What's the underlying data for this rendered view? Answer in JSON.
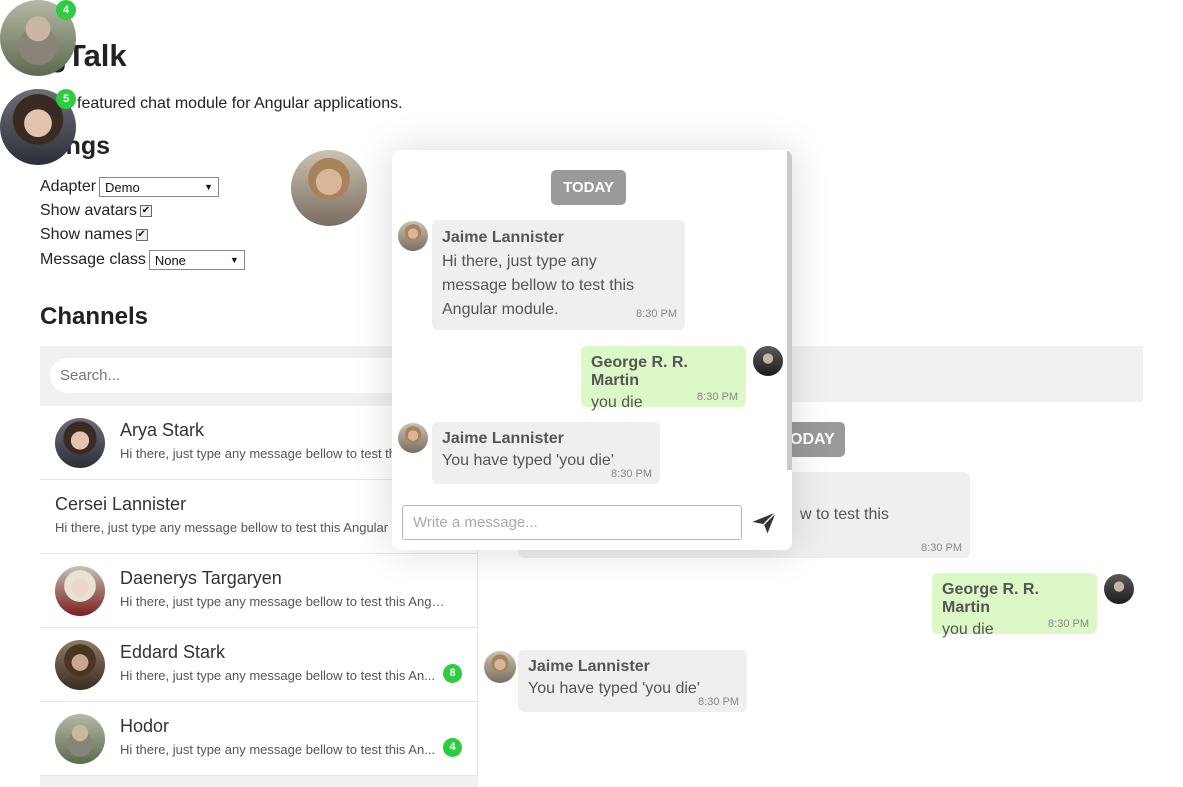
{
  "header": {
    "title": "gTalk",
    "subtitle": "featured chat module for Angular applications.",
    "settings_heading": "ttings"
  },
  "settings": {
    "adapter_label": "Adapter",
    "adapter_value": "Demo",
    "show_avatars_label": "Show avatars",
    "show_avatars_checked": true,
    "show_names_label": "Show names",
    "show_names_checked": true,
    "message_class_label": "Message class",
    "message_class_value": "None"
  },
  "floating_avatars": [
    {
      "icon": "hodor-avatar",
      "badge": "4"
    },
    {
      "icon": "arya-avatar",
      "badge": "5"
    },
    {
      "icon": "jaime-avatar",
      "badge": ""
    }
  ],
  "channels": {
    "heading": "Channels",
    "search_placeholder": "Search...",
    "friends": [
      {
        "name": "Arya Stark",
        "snippet": "Hi there, just type any message bellow to test this Angular module.",
        "badge": ""
      },
      {
        "name": "Cersei Lannister",
        "snippet": "Hi there, just type any message bellow to test this Angular",
        "badge": ""
      },
      {
        "name": "Daenerys Targaryen",
        "snippet": "Hi there, just type any message bellow to test this Angul...",
        "badge": ""
      },
      {
        "name": "Eddard Stark",
        "snippet": "Hi there, just type any message bellow to test this An...",
        "badge": "8"
      },
      {
        "name": "Hodor",
        "snippet": "Hi there, just type any message bellow to test this An...",
        "badge": "4"
      }
    ]
  },
  "background_window": {
    "date_label": "ODAY",
    "partial_message_text": "w to test this",
    "partial_message_time": "8:30 PM",
    "messages": [
      {
        "sender": "George R. R. Martin",
        "text": "you die",
        "time": "8:30 PM"
      },
      {
        "sender": "Jaime Lannister",
        "text": "You have typed 'you die'",
        "time": "8:30 PM"
      }
    ]
  },
  "popup_window": {
    "date_label": "TODAY",
    "messages": [
      {
        "sender": "Jaime Lannister",
        "text": "Hi there, just type any message bellow to test this Angular module.",
        "time": "8:30 PM"
      },
      {
        "sender": "George R. R. Martin",
        "text": "you die",
        "time": "8:30 PM"
      },
      {
        "sender": "Jaime Lannister",
        "text": "You have typed 'you die'",
        "time": "8:30 PM"
      }
    ],
    "input_placeholder": "Write a message...",
    "send_icon": "paper-plane-icon"
  },
  "colors": {
    "badge_green": "#2ecc40",
    "own_bubble": "#dcf8c6",
    "other_bubble": "#efefef",
    "date_pill": "#9a9a9a"
  }
}
